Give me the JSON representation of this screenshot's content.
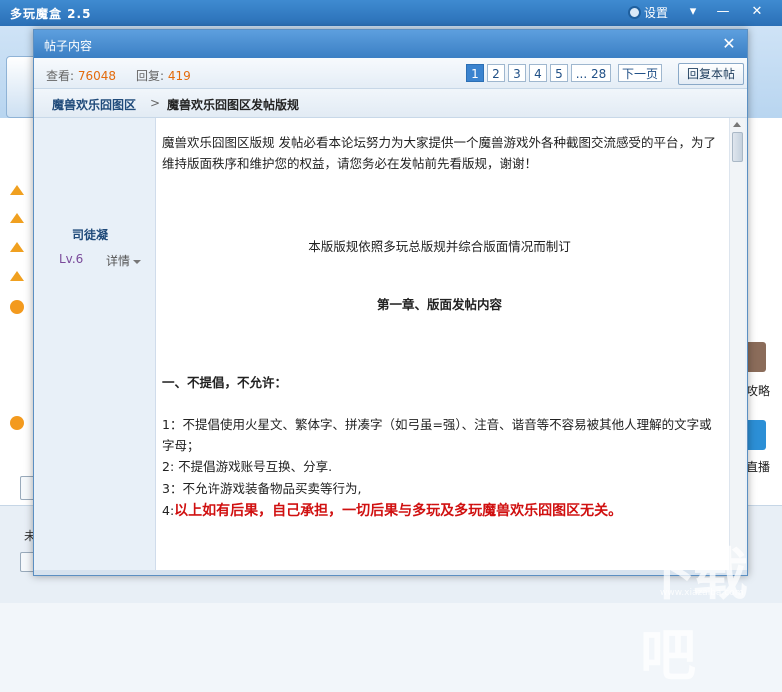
{
  "app": {
    "title": "多玩魔盒 2.5",
    "settings_label": "设置",
    "minimize": "—",
    "dropdown": "▾",
    "close": "✕"
  },
  "background": {
    "right_labels": [
      "攻略",
      "直播"
    ],
    "bottom_text": "未"
  },
  "dialog": {
    "title": "帖子内容",
    "close": "✕",
    "stats": {
      "views_label": "查看:",
      "views_value": "76048",
      "replies_label": "回复:",
      "replies_value": "419"
    },
    "pager": {
      "pages": [
        "1",
        "2",
        "3",
        "4",
        "5",
        "... 28"
      ],
      "active_page": "1",
      "next_label": "下一页"
    },
    "reply_button": "回复本帖",
    "breadcrumb": {
      "forum": "魔兽欢乐囧图区",
      "separator": ">",
      "thread": "魔兽欢乐囧图区发帖版规"
    },
    "user": {
      "name": "司徒凝",
      "level": "Lv.6",
      "detail_label": "详情"
    },
    "post": {
      "intro": "魔兽欢乐囧图区版规 发帖必看本论坛努力为大家提供一个魔兽游戏外各种截图交流感受的平台，为了维持版面秩序和维护您的权益，请您务必在发帖前先看版规，谢谢！",
      "basis": "本版版规依照多玩总版规并综合版面情况而制订",
      "chapter1": "第一章、版面发帖内容",
      "section1": "一、不提倡，不允许：",
      "rule1": "1：不提倡使用火星文、繁体字、拼凑字（如弓虽=强）、注音、谐音等不容易被其他人理解的文字或字母；",
      "rule2": "2:  不提倡游戏账号互换、分享.",
      "rule3": "3：不允许游戏装备物品买卖等行为,",
      "rule4_num": "4:",
      "rule4": "以上如有后果，自己承担，一切后果与多玩及多玩魔兽欢乐囧图区无关。"
    }
  },
  "watermark": {
    "text": "下载吧",
    "url": "www.xiazaiba.com"
  },
  "colors": {
    "accent": "#3a83cf",
    "stat_value": "#e36b0c",
    "warning_red": "#d01010"
  }
}
